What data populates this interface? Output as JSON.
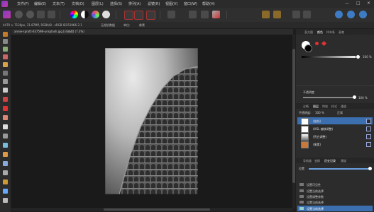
{
  "menu": {
    "items": [
      "文件(F)",
      "编辑(E)",
      "文本(T)",
      "文档(D)",
      "图层(L)",
      "选择(S)",
      "排列(A)",
      "滤镜(R)",
      "视图(V)",
      "窗口(W)",
      "帮助(H)"
    ]
  },
  "context": {
    "info": "4470 × 7130px, 31.87MP, RGBA/8 - sRGB IEC61966-2.1",
    "color_profile": "无相机数据",
    "unit_label": "单位:",
    "unit_value": "像素"
  },
  "document": {
    "tab_title": "annie-spratt-637598-unsplash.jpg [已修改] (7.3%)"
  },
  "color_panel": {
    "tabs": [
      "直方图",
      "颜色",
      "样本条",
      "画笔"
    ],
    "opacity_value": "100 %",
    "noise_label": "不透明度",
    "noise_value": "100 %",
    "accent_foreground": "#ffffff",
    "accent_background": "#000000"
  },
  "layers_panel": {
    "tabs": [
      "诊断",
      "图层",
      "特效",
      "样式",
      "通道"
    ],
    "opacity_label": "不透明度:",
    "opacity_value": "100 %",
    "blend_mode": "正常",
    "layers": [
      {
        "label": "(曲线)"
      },
      {
        "label": "(HSL 偏移调整)"
      },
      {
        "label": "(亮白调整)"
      },
      {
        "label": "(像素)"
      }
    ]
  },
  "history_panel": {
    "tabs": [
      "导航器",
      "变换",
      "历史记录",
      "通道"
    ],
    "position_label": "位置",
    "items": [
      {
        "label": "设置可见性"
      },
      {
        "label": "设置当前选择"
      },
      {
        "label": "设置调整参数"
      },
      {
        "label": "设置当前选择"
      },
      {
        "label": "设置调整参数"
      },
      {
        "label": "设置当前选择"
      }
    ]
  },
  "window_controls": {
    "minimize": "—",
    "maximize": "□",
    "close": "✕"
  }
}
